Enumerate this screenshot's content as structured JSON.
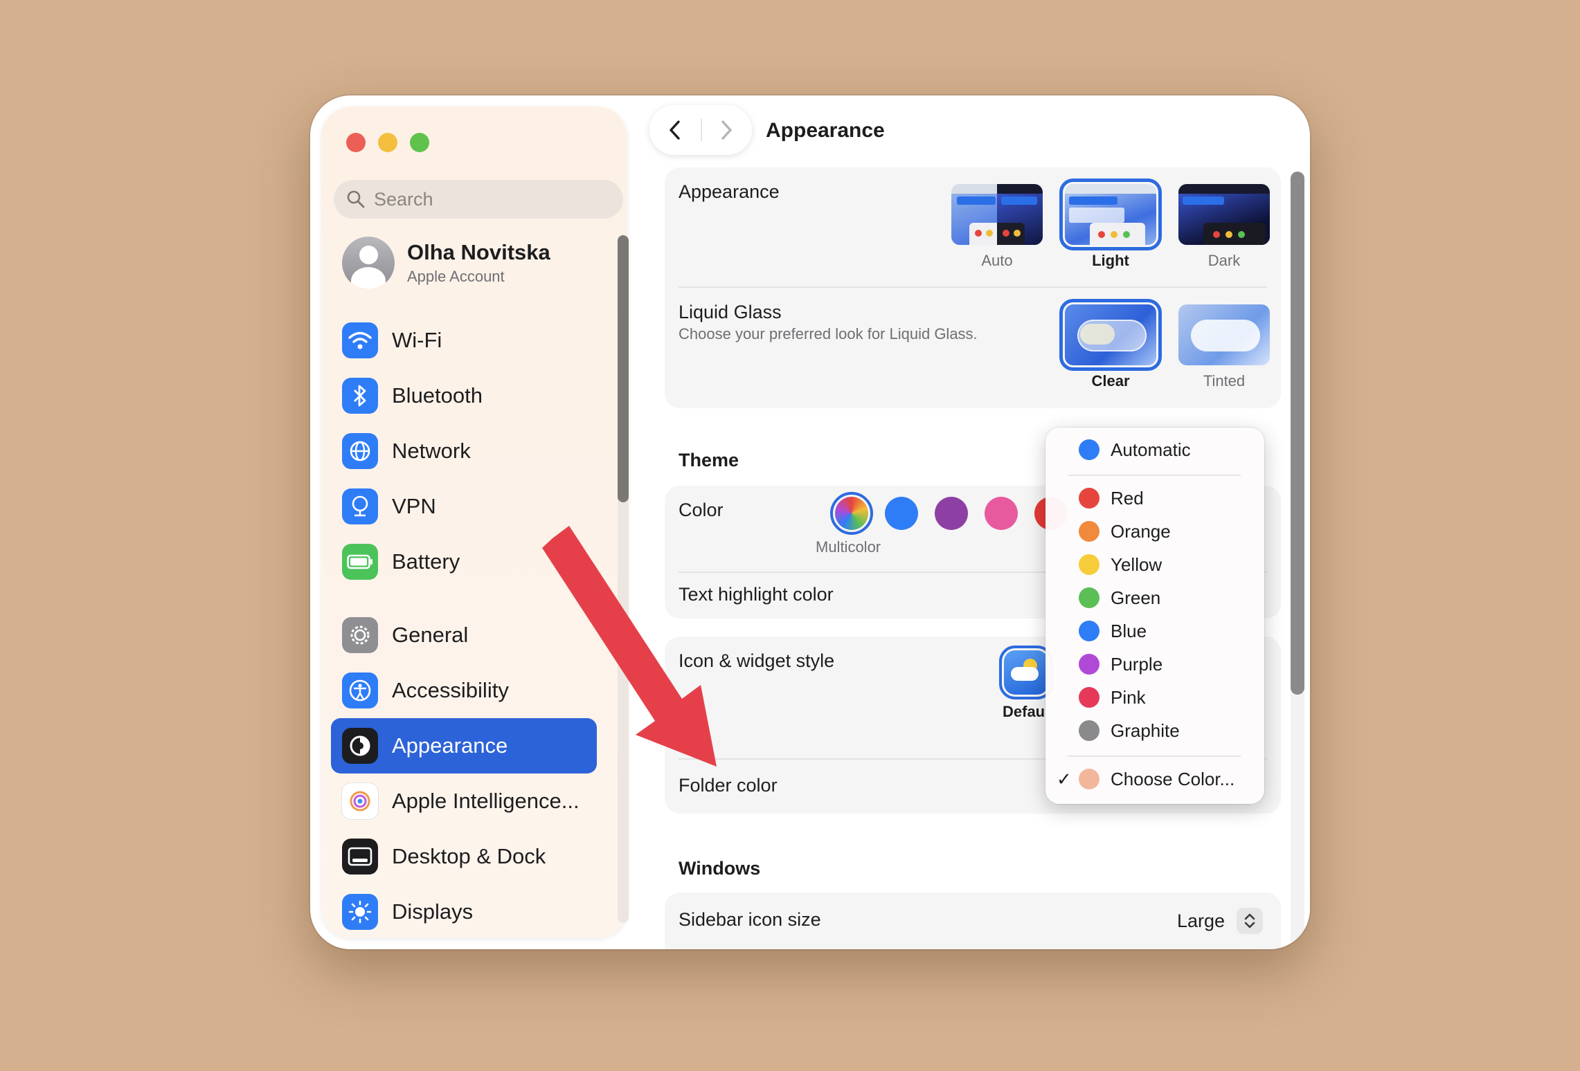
{
  "sidebar": {
    "search_placeholder": "Search",
    "account": {
      "name": "Olha Novitska",
      "subtitle": "Apple Account"
    },
    "items": [
      {
        "label": "Wi-Fi",
        "icon": "wifi-icon",
        "color": "#2f7df6"
      },
      {
        "label": "Bluetooth",
        "icon": "bluetooth-icon",
        "color": "#2f7df6"
      },
      {
        "label": "Network",
        "icon": "globe-icon",
        "color": "#2f7df6"
      },
      {
        "label": "VPN",
        "icon": "vpn-icon",
        "color": "#2f7df6"
      },
      {
        "label": "Battery",
        "icon": "battery-icon",
        "color": "#4cc35a"
      },
      {
        "label": "General",
        "icon": "gear-icon",
        "color": "#8e8e93"
      },
      {
        "label": "Accessibility",
        "icon": "accessibility-icon",
        "color": "#2f7df6"
      },
      {
        "label": "Appearance",
        "icon": "appearance-icon",
        "color": "#1d1d1f",
        "selected": true
      },
      {
        "label": "Apple Intelligence...",
        "icon": "apple-intelligence-icon",
        "color": "#ffffff"
      },
      {
        "label": "Desktop & Dock",
        "icon": "dock-icon",
        "color": "#1d1d1f"
      },
      {
        "label": "Displays",
        "icon": "sun-icon",
        "color": "#2f7df6"
      }
    ]
  },
  "header": {
    "title": "Appearance"
  },
  "appearance": {
    "label": "Appearance",
    "options": [
      {
        "label": "Auto",
        "selected": false
      },
      {
        "label": "Light",
        "selected": true
      },
      {
        "label": "Dark",
        "selected": false
      }
    ]
  },
  "liquid_glass": {
    "label": "Liquid Glass",
    "subtitle": "Choose your preferred look for Liquid Glass.",
    "options": [
      {
        "label": "Clear",
        "selected": true
      },
      {
        "label": "Tinted",
        "selected": false
      }
    ]
  },
  "theme": {
    "heading": "Theme",
    "color_label": "Color",
    "selected_caption": "Multicolor",
    "swatches": [
      "multicolor",
      "#2f7df6",
      "#8e3fa3",
      "#e85a9e",
      "#e53935"
    ],
    "text_highlight_label": "Text highlight color"
  },
  "icon_widget": {
    "label": "Icon & widget style",
    "option_caption": "Defau"
  },
  "folder_color": {
    "label": "Folder color"
  },
  "color_menu": {
    "items": [
      {
        "label": "Automatic",
        "color": "#2f7df6",
        "checked": false
      },
      {
        "label": "Red",
        "color": "#e5453d",
        "checked": false
      },
      {
        "label": "Orange",
        "color": "#f08a3c",
        "checked": false
      },
      {
        "label": "Yellow",
        "color": "#f7cc3a",
        "checked": false
      },
      {
        "label": "Green",
        "color": "#5bbf56",
        "checked": false
      },
      {
        "label": "Blue",
        "color": "#2f7df6",
        "checked": false
      },
      {
        "label": "Purple",
        "color": "#b04ad6",
        "checked": false
      },
      {
        "label": "Pink",
        "color": "#e6395a",
        "checked": false
      },
      {
        "label": "Graphite",
        "color": "#8a8a8d",
        "checked": false
      },
      {
        "label": "Choose Color...",
        "color": "#f2b79b",
        "checked": true,
        "check_mark": "✓"
      }
    ]
  },
  "windows": {
    "heading": "Windows",
    "sidebar_icon_size_label": "Sidebar icon size",
    "sidebar_icon_size_value": "Large"
  },
  "colors": {
    "accent": "#2d63d8",
    "annotation_arrow": "#e5404a"
  }
}
